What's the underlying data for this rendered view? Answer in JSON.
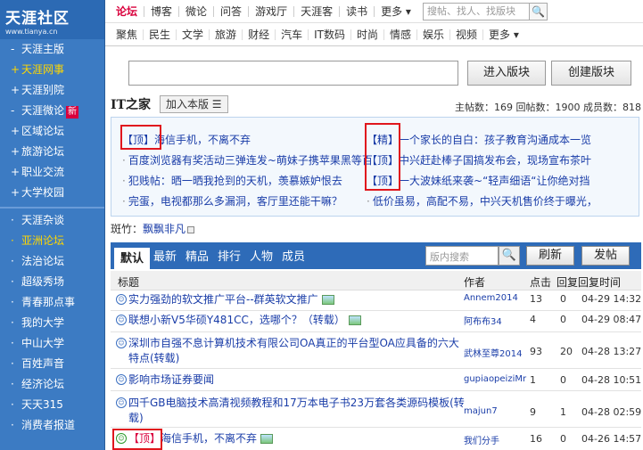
{
  "logo": {
    "name": "天涯社区",
    "url_text": "www.tianya.cn"
  },
  "sidebar": {
    "items": [
      {
        "bullet": "-",
        "label": "天涯主版"
      },
      {
        "bullet": "+",
        "label": "天涯网事"
      },
      {
        "bullet": "+",
        "label": "天涯别院"
      },
      {
        "bullet": "-",
        "label": "天涯微论",
        "badge": "新"
      },
      {
        "bullet": "+",
        "label": "区域论坛"
      },
      {
        "bullet": "+",
        "label": "旅游论坛"
      },
      {
        "bullet": "+",
        "label": "职业交流"
      },
      {
        "bullet": "+",
        "label": "大学校园"
      }
    ],
    "items2": [
      "天涯杂谈",
      "亚洲论坛",
      "法治论坛",
      "超级秀场",
      "青春那点事",
      "我的大学",
      "中山大学",
      "百姓声音",
      "经济论坛",
      "天天315",
      "消费者报道"
    ]
  },
  "topnav": {
    "items": [
      "论坛",
      "博客",
      "微论",
      "问答",
      "游戏厅",
      "天涯客",
      "读书",
      "更多 ▾"
    ],
    "search_placeholder": "搜帖、找人、找版块",
    "search_btn": "🔍"
  },
  "subnav": {
    "items": [
      "聚焦",
      "民生",
      "文学",
      "旅游",
      "财经",
      "汽车",
      "IT数码",
      "时尚",
      "情感",
      "娱乐",
      "视频",
      "更多 ▾"
    ]
  },
  "board_search": {
    "enter": "进入版块",
    "create": "创建版块"
  },
  "board": {
    "title": "IT之家",
    "add": "加入本版 ☰",
    "stats": "主帖数：169  回帖数：1900  成员数：818"
  },
  "recommend": [
    {
      "tag": "【顶】",
      "text": "海信手机，不离不弃"
    },
    {
      "tag": "",
      "text": "百度浏览器有奖活动三弹连发~萌妹子携苹果黑等百"
    },
    {
      "tag": "",
      "text": "犯贱帖：晒一晒我抢到的天机，羡慕嫉妒恨去"
    },
    {
      "tag": "",
      "text": "完蛋，电视都那么多漏洞，客厅里还能干嘛？"
    },
    {
      "tag": "【精】",
      "text": "一个家长的自白：孩子教育沟通成本一览"
    },
    {
      "tag": "【顶】",
      "text": "中兴赶赴棒子国搞发布会，现场宣布茶叶"
    },
    {
      "tag": "【顶】",
      "text": "一大波妹纸来袭~“轻声细语“让你绝对挡"
    },
    {
      "tag": "",
      "text": "低价虽易，高配不易，中兴天机售价终于曝光，"
    }
  ],
  "moderator": {
    "label": "斑竹：",
    "name": "飘飘非凡"
  },
  "tabs": {
    "items": [
      "默认",
      "最新",
      "精品",
      "排行",
      "人物",
      "成员"
    ],
    "search_placeholder": "版内搜索",
    "search_btn": "🔍",
    "refresh": "刷新",
    "post": "发帖"
  },
  "table": {
    "headers": [
      "标题",
      "作者",
      "点击",
      "回复",
      "回复时间"
    ],
    "rows": [
      {
        "title": "实力强劲的软文推广平台--群英软文推广",
        "author": "Annem2014",
        "clicks": "13",
        "replies": "0",
        "time": "04-29 14:32",
        "img": true
      },
      {
        "title": "联想小新V5华硕Y481CC，选哪个？（转载）",
        "author": "阿布布34",
        "clicks": "4",
        "replies": "0",
        "time": "04-29 08:47",
        "img": true
      },
      {
        "title": "深圳市自强不息计算机技术有限公司OA真正的平台型OA应具备的六大特点(转载)",
        "author": "武林至尊2014",
        "clicks": "93",
        "replies": "20",
        "time": "04-28 13:27",
        "img": false
      },
      {
        "title": "影响市场证券要闻",
        "author": "gupiaopeiziMr",
        "clicks": "1",
        "replies": "0",
        "time": "04-28 10:51",
        "img": false
      },
      {
        "title": "四千GB电脑技术高清视频教程和17万本电子书23万套各类源码模板(转载)",
        "author": "majun7",
        "clicks": "9",
        "replies": "1",
        "time": "04-28 02:59",
        "img": false
      },
      {
        "tag": "【顶】",
        "title": "海信手机，不离不弃",
        "author": "我们分手",
        "clicks": "16",
        "replies": "0",
        "time": "04-26 14:57",
        "img": true
      }
    ]
  }
}
